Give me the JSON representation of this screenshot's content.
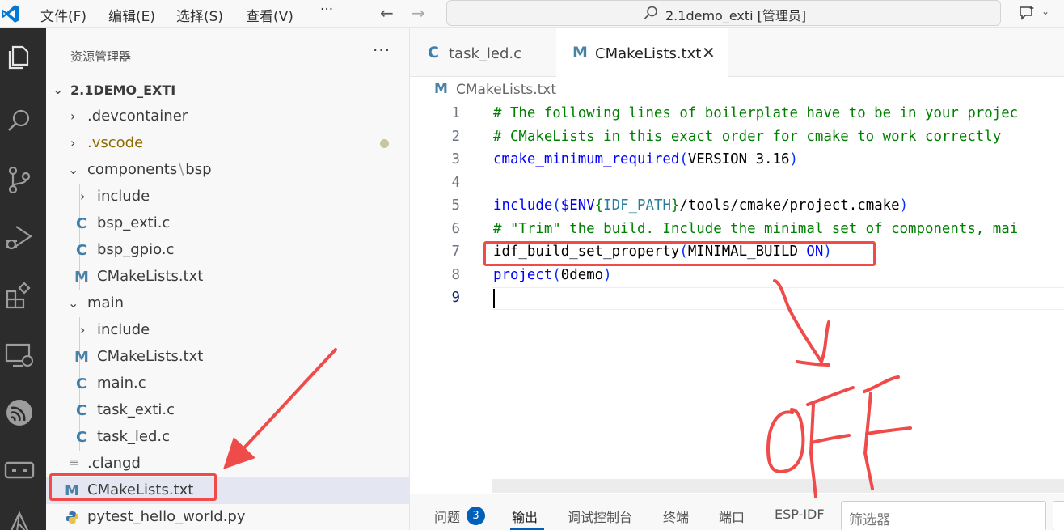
{
  "titlebar": {
    "menu": [
      "文件(F)",
      "编辑(E)",
      "选择(S)",
      "查看(V)",
      "···"
    ],
    "back_arrow": "←",
    "forward_arrow": "→",
    "command_center": "2.1demo_exti [管理员]",
    "copilot_caret": "⌄"
  },
  "activity_bar": {
    "icons": [
      "explorer-icon",
      "search-icon",
      "source-control-icon",
      "run-debug-icon",
      "extensions-icon",
      "remote-explorer-icon",
      "esp-idf-icon",
      "remote-window-icon",
      "cmake-icon"
    ]
  },
  "sidebar": {
    "title": "资源管理器",
    "more": "···",
    "root": "2.1DEMO_EXTI",
    "items": [
      {
        "label": ".devcontainer",
        "type": "folder",
        "state": "collapsed"
      },
      {
        "label": ".vscode",
        "type": "folder",
        "state": "collapsed",
        "modified": true
      },
      {
        "label": "components",
        "sep": "\\",
        "label2": "bsp",
        "type": "folder",
        "state": "expanded"
      },
      {
        "label": "include",
        "type": "folder",
        "state": "collapsed"
      },
      {
        "label": "bsp_exti.c",
        "type": "c",
        "icon": "C"
      },
      {
        "label": "bsp_gpio.c",
        "type": "c",
        "icon": "C"
      },
      {
        "label": "CMakeLists.txt",
        "type": "cmake",
        "icon": "M"
      },
      {
        "label": "main",
        "type": "folder",
        "state": "expanded"
      },
      {
        "label": "include",
        "type": "folder",
        "state": "collapsed"
      },
      {
        "label": "CMakeLists.txt",
        "type": "cmake",
        "icon": "M"
      },
      {
        "label": "main.c",
        "type": "c",
        "icon": "C"
      },
      {
        "label": "task_exti.c",
        "type": "c",
        "icon": "C"
      },
      {
        "label": "task_led.c",
        "type": "c",
        "icon": "C"
      },
      {
        "label": ".clangd",
        "type": "text"
      },
      {
        "label": "CMakeLists.txt",
        "type": "cmake",
        "icon": "M",
        "selected": true
      },
      {
        "label": "pytest_hello_world.py",
        "type": "python"
      }
    ]
  },
  "tabs": [
    {
      "label": "task_led.c",
      "icon": "C",
      "active": false
    },
    {
      "label": "CMakeLists.txt",
      "icon": "M",
      "active": true,
      "close": "✕"
    }
  ],
  "breadcrumb": {
    "icon": "M",
    "label": "CMakeLists.txt"
  },
  "editor": {
    "line_numbers": [
      "1",
      "2",
      "3",
      "4",
      "5",
      "6",
      "7",
      "8",
      "9"
    ],
    "lines": [
      {
        "comment": "# The following lines of boilerplate have to be in your projec"
      },
      {
        "comment": "# CMakeLists in this exact order for cmake to work correctly"
      },
      {
        "fn": "cmake_minimum_required",
        "open": "(",
        "arg": "VERSION 3.16",
        "close": ")"
      },
      {},
      {
        "fn": "include",
        "open": "(",
        "a1": "$ENV",
        "a2": "{",
        "a3": "IDF_PATH",
        "a4": "}",
        "a5": "/tools/cmake/project.cmake",
        "close": ")"
      },
      {
        "comment": "# \"Trim\" the build. Include the minimal set of components, mai"
      },
      {
        "fn": "idf_build_set_property",
        "open": "(",
        "a1": "MINIMAL_BUILD ",
        "a2": "ON",
        "close": ")"
      },
      {
        "fn": "project",
        "open": "(",
        "arg": "0demo",
        "close": ")"
      },
      {}
    ]
  },
  "panel": {
    "tabs": [
      "问题",
      "输出",
      "调试控制台",
      "终端",
      "端口",
      "ESP-IDF"
    ],
    "problems_count": "3",
    "filter_placeholder": "筛选器"
  },
  "colors": {
    "annotation_red": "#ef4b4b",
    "accent_blue": "#005fb8",
    "activity_bar_bg": "#2c2c2c",
    "vscode_logo": "#0078d4"
  }
}
